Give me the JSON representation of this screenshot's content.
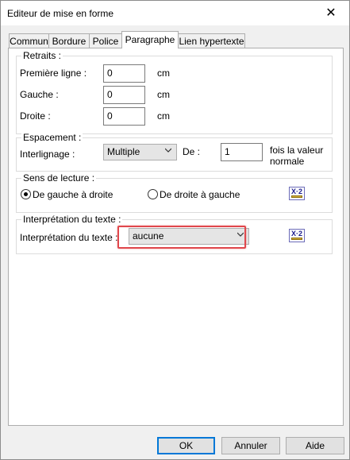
{
  "window": {
    "title": "Editeur de mise en forme",
    "close_glyph": "✕"
  },
  "tabs": [
    {
      "label": "Commun"
    },
    {
      "label": "Bordure"
    },
    {
      "label": "Police"
    },
    {
      "label": "Paragraphe",
      "active": true
    },
    {
      "label": "Lien hypertexte"
    }
  ],
  "retraits": {
    "legend": "Retraits :",
    "premiere_ligne": {
      "label": "Première ligne :",
      "value": "0",
      "unit": "cm"
    },
    "gauche": {
      "label": "Gauche :",
      "value": "0",
      "unit": "cm"
    },
    "droite": {
      "label": "Droite :",
      "value": "0",
      "unit": "cm"
    }
  },
  "espacement": {
    "legend": "Espacement :",
    "interlignage_label": "Interlignage :",
    "interlignage_value": "Multiple",
    "de_label": "De :",
    "de_value": "1",
    "suffix_line1": "fois la valeur",
    "suffix_line2": "normale"
  },
  "sens_lecture": {
    "legend": "Sens de lecture :",
    "option_ltr": "De gauche à droite",
    "option_rtl": "De droite à gauche",
    "selected": "ltr",
    "icon_text": "X·2"
  },
  "interpretation": {
    "legend": "Interprétation du texte :",
    "label": "Interprétation du texte :",
    "value": "aucune",
    "icon_text": "X·2"
  },
  "footer": {
    "ok": "OK",
    "annuler": "Annuler",
    "aide": "Aide"
  },
  "colors": {
    "highlight": "#e0474c",
    "default_button_border": "#0078d7"
  }
}
